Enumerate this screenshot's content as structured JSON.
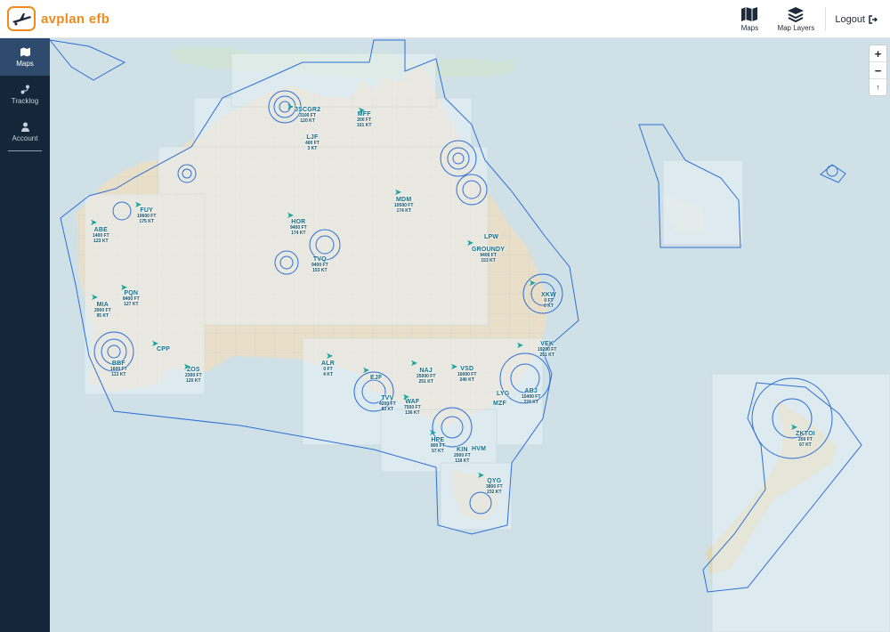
{
  "app": {
    "brand": "avplan efb"
  },
  "topnav": {
    "maps": "Maps",
    "map_layers": "Map Layers",
    "logout": "Logout"
  },
  "sidebar": {
    "items": [
      {
        "label": "Maps",
        "icon": "map-icon",
        "active": true
      },
      {
        "label": "Tracklog",
        "icon": "tracklog-icon",
        "active": false
      },
      {
        "label": "Account",
        "icon": "user-icon",
        "active": false
      }
    ]
  },
  "zoom": {
    "in": "+",
    "out": "−",
    "reset": "↑"
  },
  "colors": {
    "accent": "#ef8a1e",
    "sidebar": "#16263a",
    "sidebar_active": "#2e4a6d",
    "airspace": "#2e6fd6",
    "traffic": "#1aa39a"
  },
  "traffic": [
    {
      "cs": "JSCGR2",
      "alt": "3100 FT",
      "spd": "120 KT"
    },
    {
      "cs": "MFF",
      "alt": "200 FT",
      "spd": "101 KT"
    },
    {
      "cs": "LJF",
      "alt": "400 FT",
      "spd": "3 KT"
    },
    {
      "cs": "FUY",
      "alt": "10600 FT",
      "spd": "175 KT"
    },
    {
      "cs": "ABE",
      "alt": "1400 FT",
      "spd": "123 KT"
    },
    {
      "cs": "MDM",
      "alt": "10500 FT",
      "spd": "174 KT"
    },
    {
      "cs": "HOR",
      "alt": "9400 FT",
      "spd": "174 KT"
    },
    {
      "cs": "TVQ",
      "alt": "9400 FT",
      "spd": "153 KT"
    },
    {
      "cs": "LPW",
      "alt": "",
      "spd": ""
    },
    {
      "cs": "GROUNDY",
      "alt": "9400 FT",
      "spd": "153 KT"
    },
    {
      "cs": "PQN",
      "alt": "8400 FT",
      "spd": "127 KT"
    },
    {
      "cs": "MIA",
      "alt": "2000 FT",
      "spd": "95 KT"
    },
    {
      "cs": "CPP",
      "alt": "",
      "spd": ""
    },
    {
      "cs": "BBF",
      "alt": "1600 FT",
      "spd": "113 KT"
    },
    {
      "cs": "ZOS",
      "alt": "2300 FT",
      "spd": "120 KT"
    },
    {
      "cs": "ALR",
      "alt": "0 FT",
      "spd": "4 KT"
    },
    {
      "cs": "EJF",
      "alt": "",
      "spd": ""
    },
    {
      "cs": "TVV",
      "alt": "4200 FT",
      "spd": "83 KT"
    },
    {
      "cs": "NAJ",
      "alt": "25000 FT",
      "spd": "251 KT"
    },
    {
      "cs": "VSD",
      "alt": "16000 FT",
      "spd": "240 KT"
    },
    {
      "cs": "WAF",
      "alt": "7500 FT",
      "spd": "136 KT"
    },
    {
      "cs": "HPE",
      "alt": "800 FT",
      "spd": "57 KT"
    },
    {
      "cs": "KIN",
      "alt": "2000 FT",
      "spd": "118 KT"
    },
    {
      "cs": "HVM",
      "alt": "",
      "spd": ""
    },
    {
      "cs": "QYG",
      "alt": "3800 FT",
      "spd": "232 KT"
    },
    {
      "cs": "VEK",
      "alt": "19200 FT",
      "spd": "251 KT"
    },
    {
      "cs": "ABJ",
      "alt": "15400 FT",
      "spd": "224 KT"
    },
    {
      "cs": "MZF",
      "alt": "",
      "spd": ""
    },
    {
      "cs": "LYG",
      "alt": "",
      "spd": ""
    },
    {
      "cs": "XKW",
      "alt": "0 FT",
      "spd": "0 KT"
    },
    {
      "cs": "ZKTOI",
      "alt": "200 FT",
      "spd": "67 KT"
    }
  ]
}
